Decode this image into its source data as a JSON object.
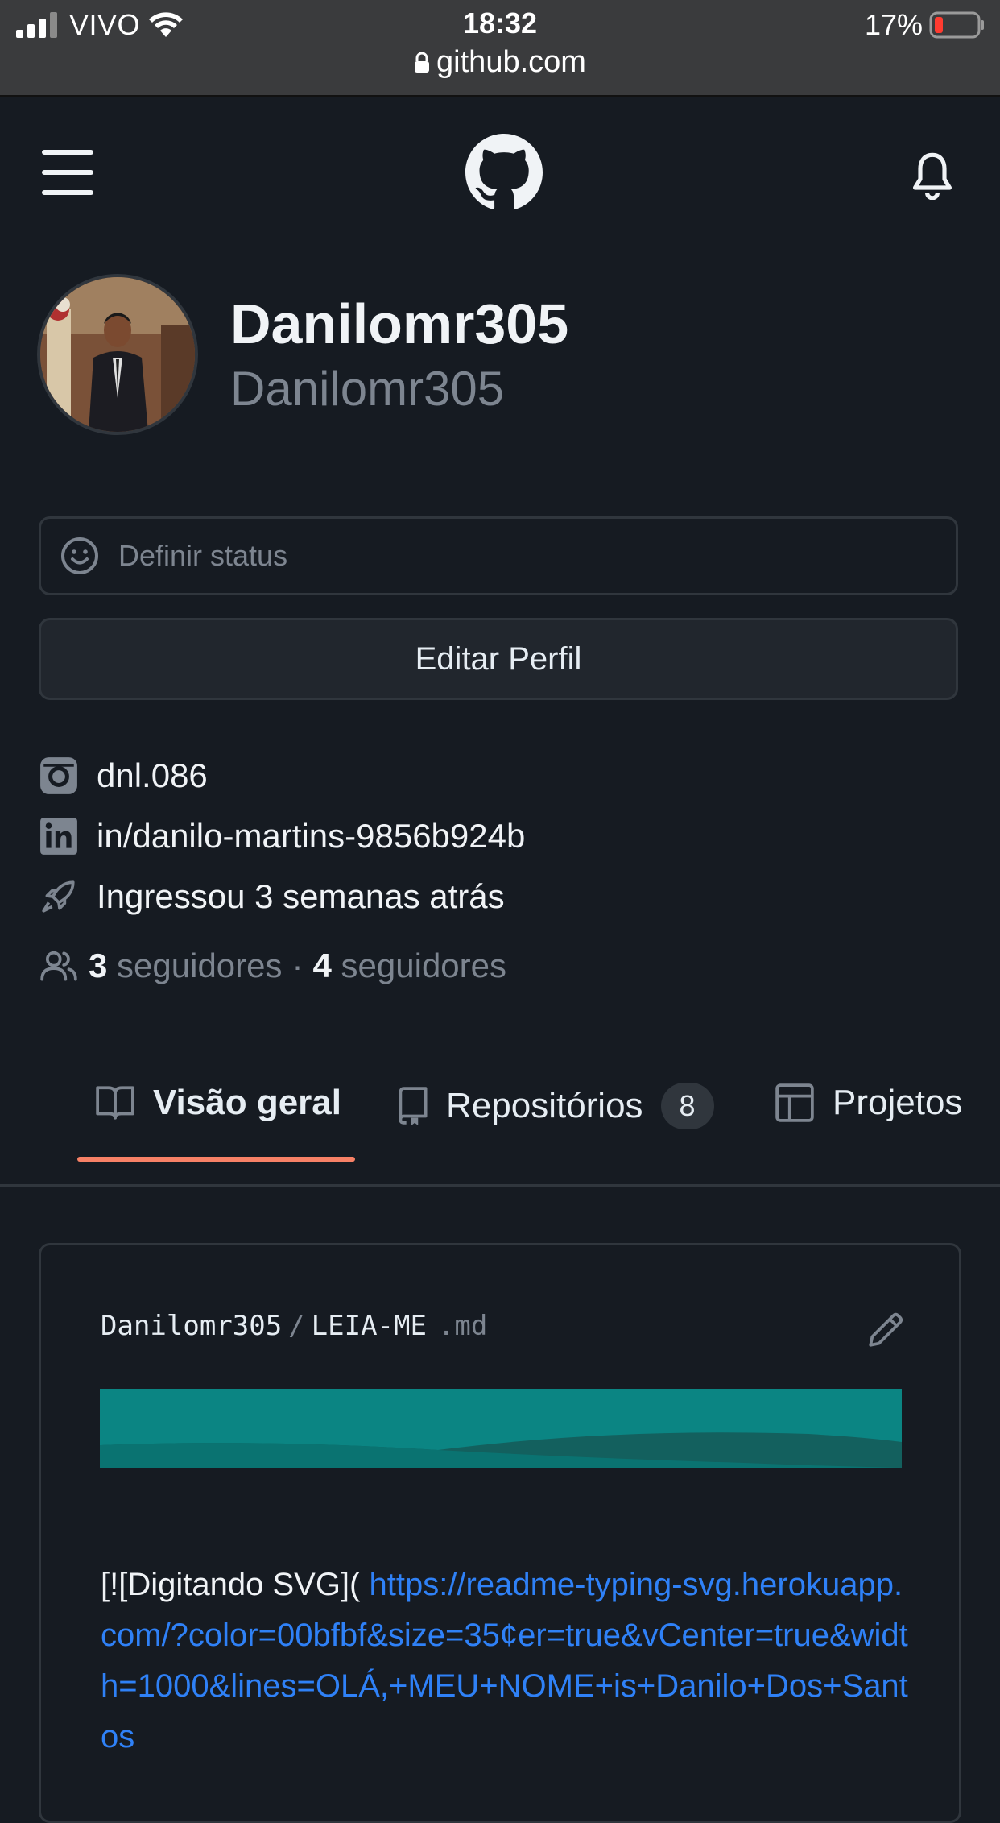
{
  "status_bar": {
    "carrier": "VIVO",
    "time": "18:32",
    "battery": "17%",
    "url": "github.com"
  },
  "profile": {
    "name": "Danilomr305",
    "login": "Danilomr305",
    "status_placeholder": "Definir status",
    "edit_label": "Editar Perfil",
    "instagram": "dnl.086",
    "linkedin": "in/danilo-martins-9856b924b",
    "joined": "Ingressou 3 semanas atrás",
    "followers_count": "3",
    "followers_label": "seguidores",
    "separator": "·",
    "following_count": "4",
    "following_label": "seguidores"
  },
  "tabs": [
    {
      "label": "Visão geral",
      "icon": "book-icon"
    },
    {
      "label": "Repositórios",
      "icon": "repo-icon",
      "count": "8"
    },
    {
      "label": "Projetos",
      "icon": "table-icon"
    }
  ],
  "readme": {
    "owner": "Danilomr305",
    "slash": "/",
    "name": "LEIA-ME",
    "ext": ".md",
    "text_prefix": "[![Digitando SVG](",
    "link": " https://readme-typing-svg.herokuapp.com/?color=00bfbf&size=35¢er=true&vCenter=true&width=1000&lines=OLÁ,+MEU+NOME+is+Danilo+Dos+Santos"
  },
  "colors": {
    "accent": "#f78166",
    "link": "#2f81f7",
    "banner_top": "#0b8583",
    "banner_bottom": "#13605e"
  }
}
